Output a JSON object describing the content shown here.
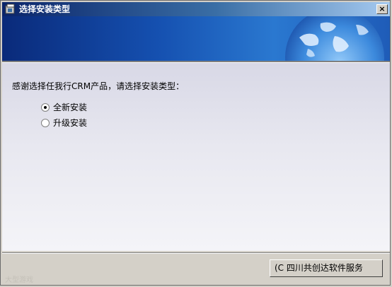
{
  "window": {
    "title": "选择安装类型",
    "close_glyph": "×"
  },
  "content": {
    "prompt": "感谢选择任我行CRM产品，请选择安装类型：",
    "options": [
      {
        "label": "全新安装",
        "selected": true
      },
      {
        "label": "升级安装",
        "selected": false
      }
    ]
  },
  "footer": {
    "button_label": "(C 四川共创达软件服务",
    "watermark": "大型游戏"
  }
}
